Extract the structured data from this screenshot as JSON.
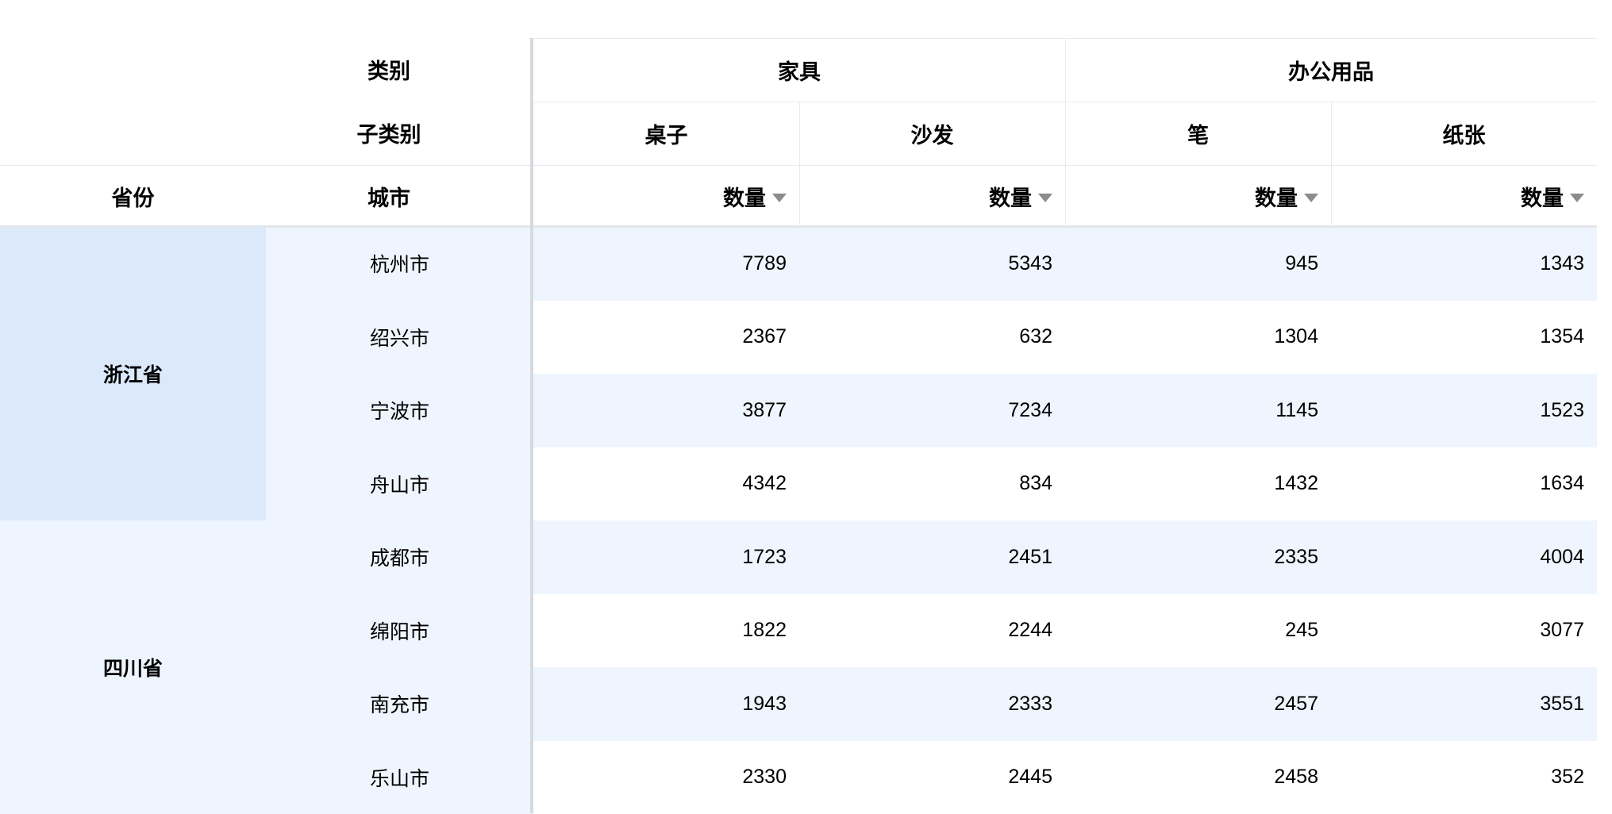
{
  "corner": {
    "category_label": "类别",
    "subcategory_label": "子类别",
    "province_label": "省份",
    "city_label": "城市"
  },
  "columns": {
    "categories": [
      {
        "label": "家具",
        "subcategories": [
          "桌子",
          "沙发"
        ]
      },
      {
        "label": "办公用品",
        "subcategories": [
          "笔",
          "纸张"
        ]
      }
    ],
    "measure_label": "数量"
  },
  "rows": [
    {
      "province": "浙江省",
      "cities": [
        {
          "city": "杭州市",
          "values": [
            "7789",
            "5343",
            "945",
            "1343"
          ]
        },
        {
          "city": "绍兴市",
          "values": [
            "2367",
            "632",
            "1304",
            "1354"
          ]
        },
        {
          "city": "宁波市",
          "values": [
            "3877",
            "7234",
            "1145",
            "1523"
          ]
        },
        {
          "city": "舟山市",
          "values": [
            "4342",
            "834",
            "1432",
            "1634"
          ]
        }
      ]
    },
    {
      "province": "四川省",
      "cities": [
        {
          "city": "成都市",
          "values": [
            "1723",
            "2451",
            "2335",
            "4004"
          ]
        },
        {
          "city": "绵阳市",
          "values": [
            "1822",
            "2244",
            "245",
            "3077"
          ]
        },
        {
          "city": "南充市",
          "values": [
            "1943",
            "2333",
            "2457",
            "3551"
          ]
        },
        {
          "city": "乐山市",
          "values": [
            "2330",
            "2445",
            "2458",
            "352"
          ]
        }
      ]
    }
  ],
  "colors": {
    "province_selected_bg": "#dce9fb",
    "row_header_bg": "#eff5fe",
    "stripe_bg": "#eff5fe",
    "white_bg": "#ffffff",
    "sort_icon": "#8c8c8c"
  }
}
